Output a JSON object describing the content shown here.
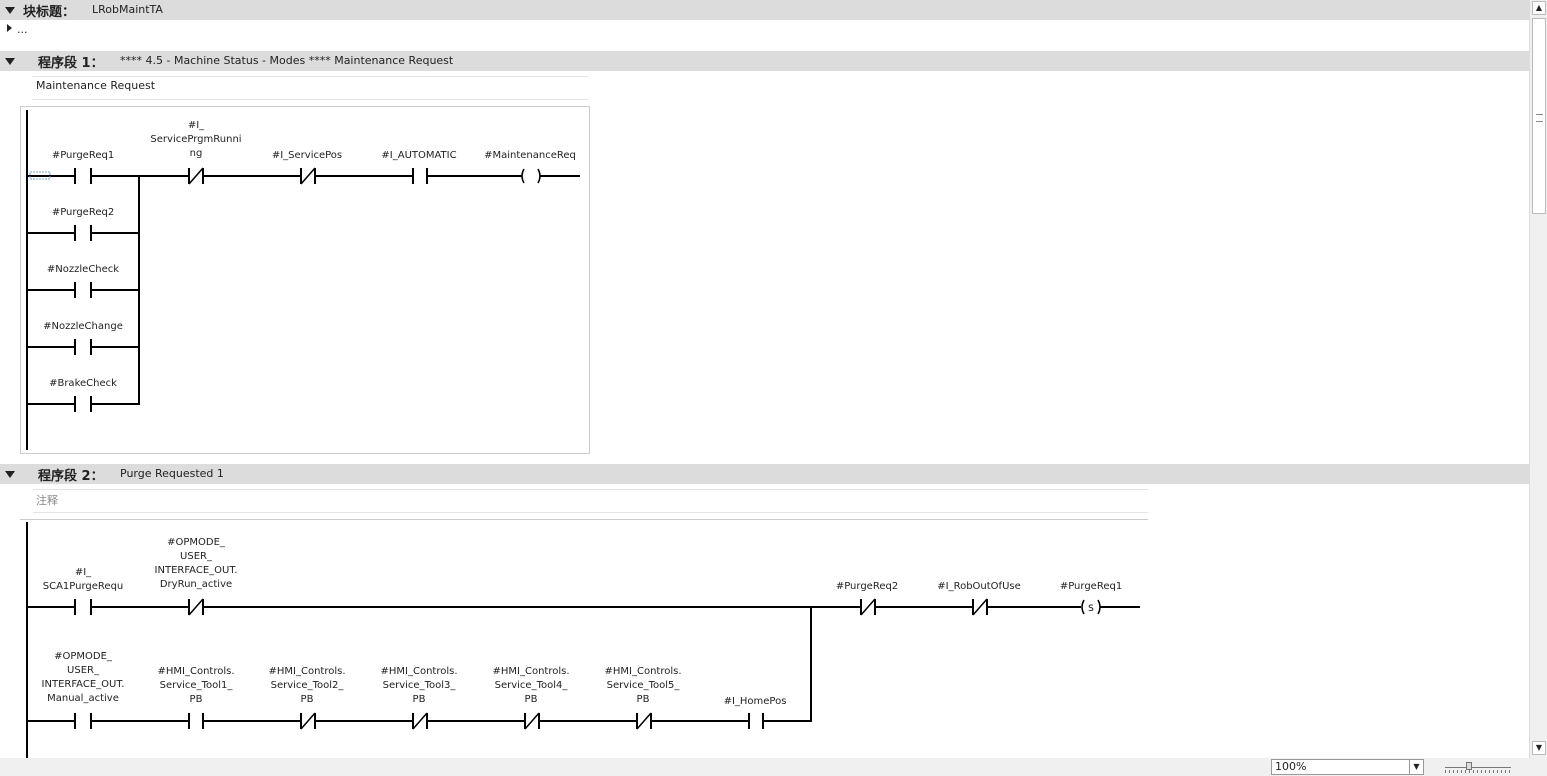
{
  "block": {
    "title_label": "块标题：",
    "title_value": "LRobMaintTA",
    "ellipsis": "..."
  },
  "networks": [
    {
      "label": "程序段 1：",
      "title": "**** 4.5 - Machine Status - Modes **** Maintenance Request",
      "comment": "Maintenance Request",
      "contacts": [
        {
          "label": "#PurgeReq1"
        },
        {
          "label": "#I_\nServicePrgmRunni\nng"
        },
        {
          "label": "#I_ServicePos"
        },
        {
          "label": "#I_AUTOMATIC"
        },
        {
          "label": "#MaintenanceReq"
        },
        {
          "label": "#PurgeReq2"
        },
        {
          "label": "#NozzleCheck"
        },
        {
          "label": "#NozzleChange"
        },
        {
          "label": "#BrakeCheck"
        }
      ]
    },
    {
      "label": "程序段 2：",
      "title": "Purge Requested 1",
      "comment": "注释",
      "contacts": [
        {
          "label": "#I_\nSCA1PurgeRequ"
        },
        {
          "label": "#OPMODE_\nUSER_\nINTERFACE_OUT.\nDryRun_active"
        },
        {
          "label": "#PurgeReq2"
        },
        {
          "label": "#I_RobOutOfUse"
        },
        {
          "label": "#PurgeReq1"
        },
        {
          "label": "#OPMODE_\nUSER_\nINTERFACE_OUT.\nManual_active"
        },
        {
          "label": "#HMI_Controls.\nService_Tool1_\nPB"
        },
        {
          "label": "#HMI_Controls.\nService_Tool2_\nPB"
        },
        {
          "label": "#HMI_Controls.\nService_Tool3_\nPB"
        },
        {
          "label": "#HMI_Controls.\nService_Tool4_\nPB"
        },
        {
          "label": "#HMI_Controls.\nService_Tool5_\nPB"
        },
        {
          "label": "#I_HomePos"
        }
      ]
    }
  ],
  "zoom": {
    "value": "100%"
  }
}
